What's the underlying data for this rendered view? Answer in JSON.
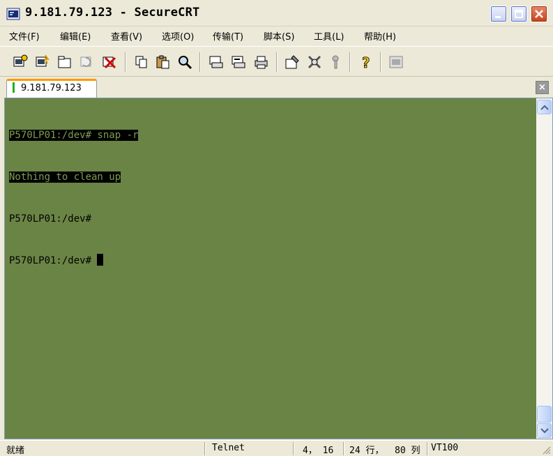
{
  "window": {
    "title": "9.181.79.123 - SecureCRT",
    "icon": "securecrt-app-icon",
    "controls": [
      "minimize-icon",
      "maximize-icon",
      "close-icon"
    ]
  },
  "menu": {
    "items": [
      {
        "label": "文件(F)"
      },
      {
        "label": "编辑(E)"
      },
      {
        "label": "查看(V)"
      },
      {
        "label": "选项(O)"
      },
      {
        "label": "传输(T)"
      },
      {
        "label": "脚本(S)"
      },
      {
        "label": "工具(L)"
      },
      {
        "label": "帮助(H)"
      }
    ]
  },
  "toolbar": {
    "icons": [
      "connect-icon",
      "quick-connect-icon",
      "connect-tab-icon",
      "reconnect-icon",
      "disconnect-icon",
      "copy-icon",
      "paste-icon",
      "find-icon",
      "print-setup-icon",
      "print-selection-icon",
      "print-icon",
      "session-options-icon",
      "global-options-icon",
      "keymap-icon",
      "help-icon",
      "sftp-icon"
    ]
  },
  "tabs": [
    {
      "label": "9.181.79.123",
      "active": true
    }
  ],
  "terminal": {
    "background": "#6a8445",
    "lines": [
      {
        "text": "P570LP01:/dev# snap -r",
        "highlight": true
      },
      {
        "text": "Nothing to clean up",
        "highlight": true
      },
      {
        "text": "P570LP01:/dev#",
        "highlight": false
      },
      {
        "text": "P570LP01:/dev# ",
        "highlight": false,
        "cursor": true
      }
    ]
  },
  "status": {
    "ready": "就绪",
    "protocol": "Telnet",
    "position": "4， 16",
    "rows": "24 行，",
    "cols": "80 列",
    "emulation": "VT100"
  }
}
